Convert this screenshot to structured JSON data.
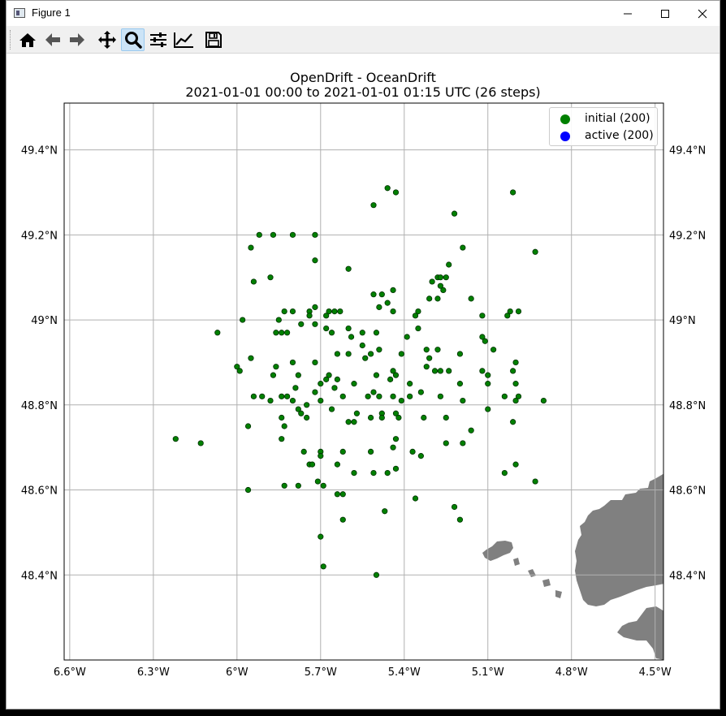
{
  "window": {
    "title": "Figure 1"
  },
  "toolbar": {
    "buttons": [
      {
        "name": "home-icon",
        "active": false
      },
      {
        "name": "back-arrow-icon",
        "active": false
      },
      {
        "name": "forward-arrow-icon",
        "active": false
      },
      {
        "name": "pan-icon",
        "active": false
      },
      {
        "name": "zoom-icon",
        "active": true
      },
      {
        "name": "subplots-config-icon",
        "active": false
      },
      {
        "name": "edit-axis-icon",
        "active": false
      },
      {
        "name": "save-icon",
        "active": false
      }
    ]
  },
  "figure": {
    "title_line1": "OpenDrift - OceanDrift",
    "title_line2": "2021-01-01 00:00 to 2021-01-01 01:15 UTC (26 steps)"
  },
  "legend": {
    "items": [
      {
        "label": "initial (200)",
        "color": "#008000"
      },
      {
        "label": "active (200)",
        "color": "#0000ff"
      }
    ]
  },
  "colors": {
    "particle_fill": "#008000",
    "particle_edge": "#003000",
    "land": "#808080",
    "grid": "#b0b0b0"
  },
  "chart_data": {
    "type": "scatter",
    "title": "OpenDrift - OceanDrift",
    "subtitle": "2021-01-01 00:00 to 2021-01-01 01:15 UTC (26 steps)",
    "xlim": [
      -6.62,
      -4.47
    ],
    "ylim": [
      48.2,
      49.51
    ],
    "xticks": [
      {
        "v": -6.6,
        "label": "6.6°W"
      },
      {
        "v": -6.3,
        "label": "6.3°W"
      },
      {
        "v": -6.0,
        "label": "6°W"
      },
      {
        "v": -5.7,
        "label": "5.7°W"
      },
      {
        "v": -5.4,
        "label": "5.4°W"
      },
      {
        "v": -5.1,
        "label": "5.1°W"
      },
      {
        "v": -4.8,
        "label": "4.8°W"
      },
      {
        "v": -4.5,
        "label": "4.5°W"
      }
    ],
    "yticks": [
      {
        "v": 48.4,
        "label": "48.4°N"
      },
      {
        "v": 48.6,
        "label": "48.6°N"
      },
      {
        "v": 48.8,
        "label": "48.8°N"
      },
      {
        "v": 49.0,
        "label": "49°N"
      },
      {
        "v": 49.2,
        "label": "49.2°N"
      },
      {
        "v": 49.4,
        "label": "49.4°N"
      }
    ],
    "grid": true,
    "legend_position": "top-right",
    "series": [
      {
        "name": "initial (200)",
        "color": "#008000",
        "points": [
          [
            -5.46,
            49.31
          ],
          [
            -5.43,
            49.3
          ],
          [
            -5.51,
            49.27
          ],
          [
            -5.22,
            49.25
          ],
          [
            -5.01,
            49.3
          ],
          [
            -5.19,
            49.17
          ],
          [
            -4.93,
            49.16
          ],
          [
            -5.92,
            49.2
          ],
          [
            -5.87,
            49.2
          ],
          [
            -5.8,
            49.2
          ],
          [
            -5.72,
            49.2
          ],
          [
            -5.95,
            49.17
          ],
          [
            -5.72,
            49.14
          ],
          [
            -5.24,
            49.13
          ],
          [
            -5.6,
            49.12
          ],
          [
            -5.28,
            49.1
          ],
          [
            -5.3,
            49.09
          ],
          [
            -5.27,
            49.1
          ],
          [
            -5.25,
            49.1
          ],
          [
            -5.88,
            49.1
          ],
          [
            -5.94,
            49.09
          ],
          [
            -5.27,
            49.08
          ],
          [
            -5.26,
            49.07
          ],
          [
            -5.44,
            49.07
          ],
          [
            -5.51,
            49.06
          ],
          [
            -5.48,
            49.06
          ],
          [
            -5.31,
            49.05
          ],
          [
            -5.28,
            49.05
          ],
          [
            -5.16,
            49.05
          ],
          [
            -5.72,
            49.03
          ],
          [
            -5.67,
            49.02
          ],
          [
            -5.46,
            49.04
          ],
          [
            -5.49,
            49.03
          ],
          [
            -5.44,
            49.02
          ],
          [
            -5.35,
            49.02
          ],
          [
            -5.65,
            49.02
          ],
          [
            -5.63,
            49.02
          ],
          [
            -5.74,
            49.02
          ],
          [
            -5.83,
            49.02
          ],
          [
            -5.8,
            49.02
          ],
          [
            -5.74,
            49.01
          ],
          [
            -5.68,
            49.01
          ],
          [
            -5.36,
            49.01
          ],
          [
            -5.02,
            49.02
          ],
          [
            -5.03,
            49.01
          ],
          [
            -4.99,
            49.02
          ],
          [
            -5.12,
            49.01
          ],
          [
            -5.98,
            49.0
          ],
          [
            -5.85,
            49.0
          ],
          [
            -5.77,
            48.99
          ],
          [
            -5.72,
            48.99
          ],
          [
            -5.66,
            48.97
          ],
          [
            -5.6,
            48.98
          ],
          [
            -5.55,
            48.97
          ],
          [
            -5.5,
            48.97
          ],
          [
            -5.39,
            48.96
          ],
          [
            -5.35,
            48.98
          ],
          [
            -5.59,
            48.96
          ],
          [
            -5.68,
            48.98
          ],
          [
            -5.82,
            48.97
          ],
          [
            -5.84,
            48.97
          ],
          [
            -5.86,
            48.97
          ],
          [
            -6.07,
            48.97
          ],
          [
            -5.12,
            48.96
          ],
          [
            -5.11,
            48.95
          ],
          [
            -5.55,
            48.94
          ],
          [
            -5.49,
            48.93
          ],
          [
            -5.41,
            48.92
          ],
          [
            -5.28,
            48.93
          ],
          [
            -5.32,
            48.93
          ],
          [
            -5.64,
            48.92
          ],
          [
            -5.52,
            48.92
          ],
          [
            -5.54,
            48.91
          ],
          [
            -5.2,
            48.92
          ],
          [
            -5.08,
            48.93
          ],
          [
            -5.95,
            48.91
          ],
          [
            -5.8,
            48.9
          ],
          [
            -5.72,
            48.9
          ],
          [
            -5.86,
            48.89
          ],
          [
            -5.87,
            48.87
          ],
          [
            -5.78,
            48.87
          ],
          [
            -5.5,
            48.87
          ],
          [
            -5.43,
            48.87
          ],
          [
            -5.29,
            48.88
          ],
          [
            -5.27,
            48.88
          ],
          [
            -5.32,
            48.89
          ],
          [
            -5.31,
            48.91
          ],
          [
            -5.6,
            48.92
          ],
          [
            -5.24,
            48.88
          ],
          [
            -5.12,
            48.88
          ],
          [
            -5.1,
            48.87
          ],
          [
            -5.01,
            48.88
          ],
          [
            -5.0,
            48.9
          ],
          [
            -6.0,
            48.89
          ],
          [
            -5.99,
            48.88
          ],
          [
            -5.67,
            48.87
          ],
          [
            -5.64,
            48.86
          ],
          [
            -5.68,
            48.86
          ],
          [
            -5.7,
            48.85
          ],
          [
            -5.58,
            48.85
          ],
          [
            -5.45,
            48.86
          ],
          [
            -5.44,
            48.88
          ],
          [
            -5.38,
            48.85
          ],
          [
            -5.2,
            48.85
          ],
          [
            -5.1,
            48.85
          ],
          [
            -5.0,
            48.85
          ],
          [
            -5.79,
            48.84
          ],
          [
            -5.65,
            48.84
          ],
          [
            -5.51,
            48.83
          ],
          [
            -5.34,
            48.83
          ],
          [
            -4.99,
            48.82
          ],
          [
            -5.72,
            48.83
          ],
          [
            -5.82,
            48.82
          ],
          [
            -5.84,
            48.82
          ],
          [
            -5.8,
            48.81
          ],
          [
            -5.88,
            48.81
          ],
          [
            -5.78,
            48.79
          ],
          [
            -5.75,
            48.8
          ],
          [
            -5.7,
            48.81
          ],
          [
            -5.62,
            48.82
          ],
          [
            -5.53,
            48.82
          ],
          [
            -5.49,
            48.82
          ],
          [
            -5.44,
            48.82
          ],
          [
            -5.41,
            48.81
          ],
          [
            -5.38,
            48.82
          ],
          [
            -5.27,
            48.82
          ],
          [
            -5.19,
            48.81
          ],
          [
            -5.04,
            48.82
          ],
          [
            -5.0,
            48.81
          ],
          [
            -4.9,
            48.81
          ],
          [
            -5.94,
            48.82
          ],
          [
            -5.91,
            48.82
          ],
          [
            -5.77,
            48.78
          ],
          [
            -5.66,
            48.79
          ],
          [
            -5.57,
            48.78
          ],
          [
            -5.48,
            48.78
          ],
          [
            -5.43,
            48.78
          ],
          [
            -5.42,
            48.77
          ],
          [
            -5.33,
            48.77
          ],
          [
            -5.25,
            48.77
          ],
          [
            -5.1,
            48.79
          ],
          [
            -5.01,
            48.76
          ],
          [
            -5.84,
            48.77
          ],
          [
            -5.75,
            48.77
          ],
          [
            -5.6,
            48.76
          ],
          [
            -5.58,
            48.76
          ],
          [
            -5.52,
            48.77
          ],
          [
            -5.48,
            48.77
          ],
          [
            -5.96,
            48.75
          ],
          [
            -5.83,
            48.75
          ],
          [
            -5.84,
            48.72
          ],
          [
            -5.43,
            48.72
          ],
          [
            -5.16,
            48.74
          ],
          [
            -5.25,
            48.71
          ],
          [
            -5.19,
            48.71
          ],
          [
            -6.22,
            48.72
          ],
          [
            -6.13,
            48.71
          ],
          [
            -5.76,
            48.69
          ],
          [
            -5.7,
            48.69
          ],
          [
            -5.7,
            48.68
          ],
          [
            -5.62,
            48.69
          ],
          [
            -5.52,
            48.69
          ],
          [
            -5.44,
            48.7
          ],
          [
            -5.37,
            48.69
          ],
          [
            -5.34,
            48.68
          ],
          [
            -5.74,
            48.66
          ],
          [
            -5.73,
            48.66
          ],
          [
            -5.64,
            48.66
          ],
          [
            -5.46,
            48.64
          ],
          [
            -5.43,
            48.65
          ],
          [
            -5.51,
            48.64
          ],
          [
            -5.58,
            48.64
          ],
          [
            -5.04,
            48.64
          ],
          [
            -5.0,
            48.66
          ],
          [
            -4.93,
            48.62
          ],
          [
            -5.71,
            48.62
          ],
          [
            -5.69,
            48.61
          ],
          [
            -5.83,
            48.61
          ],
          [
            -5.78,
            48.61
          ],
          [
            -5.96,
            48.6
          ],
          [
            -5.64,
            48.59
          ],
          [
            -5.62,
            48.59
          ],
          [
            -5.36,
            48.58
          ],
          [
            -5.22,
            48.56
          ],
          [
            -5.47,
            48.55
          ],
          [
            -5.62,
            48.53
          ],
          [
            -5.2,
            48.53
          ],
          [
            -5.7,
            48.49
          ],
          [
            -5.69,
            48.42
          ],
          [
            -5.5,
            48.4
          ]
        ]
      },
      {
        "name": "active (200)",
        "color": "#0000ff",
        "points": []
      }
    ]
  }
}
